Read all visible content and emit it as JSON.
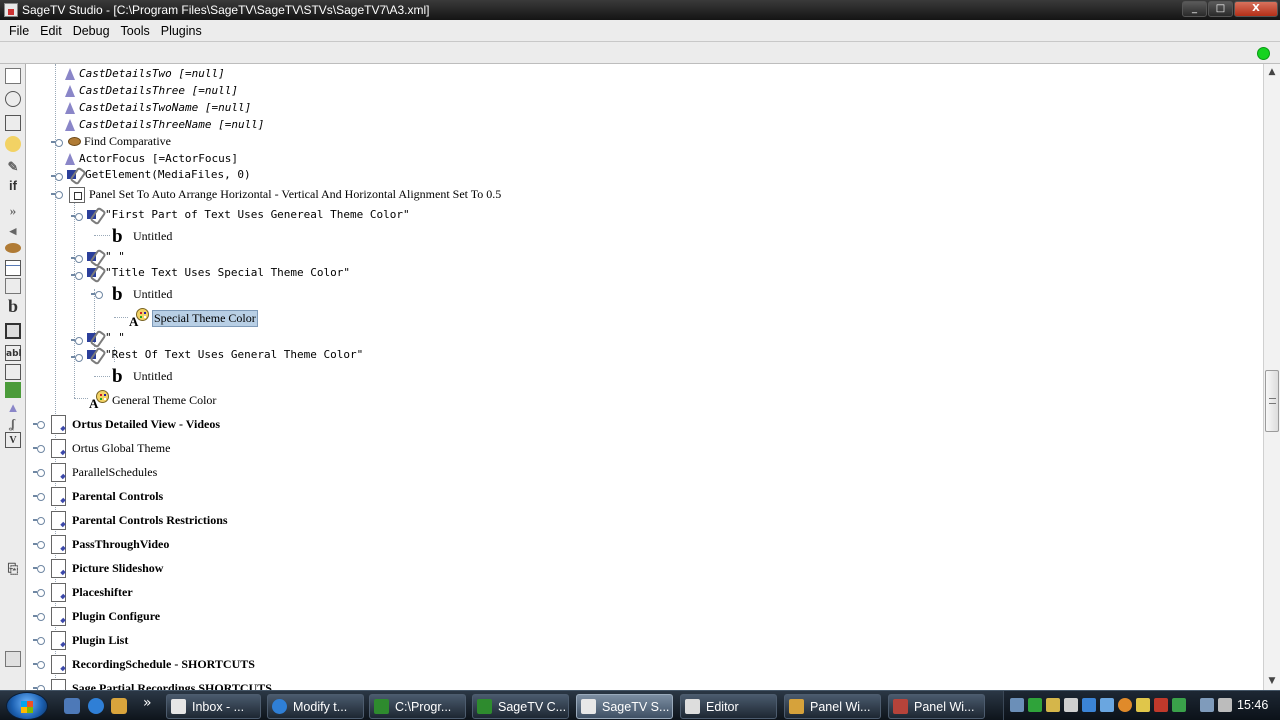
{
  "window": {
    "title": "SageTV Studio - [C:\\Program Files\\SageTV\\SageTV\\STVs\\SageTV7\\A3.xml]",
    "minimize": "_",
    "maximize": "□",
    "close": "X"
  },
  "menu": [
    "File",
    "Edit",
    "Debug",
    "Tools",
    "Plugins"
  ],
  "palette": [
    "menu-icon",
    "balloon-icon",
    "panel-icon",
    "theme-icon",
    "action-icon",
    "conditional-icon",
    "branch-icon",
    "sound-icon",
    "listener-icon",
    "table-icon",
    "table-component-icon",
    "text-icon",
    "image-icon",
    "textinput-icon",
    "video-icon",
    "effect-icon",
    "attribute-icon",
    "hook-icon",
    "shortcut-icon",
    "paste-icon",
    "trash-icon"
  ],
  "palette_glyphs": {
    "conditional": "if",
    "text": "b",
    "textinput": "abl"
  },
  "tree": {
    "r1": "CastDetailsTwo [=null]",
    "r2": "CastDetailsThree [=null]",
    "r3": "CastDetailsTwoName [=null]",
    "r4": "CastDetailsThreeName [=null]",
    "r5": "Find Comparative",
    "r6": "ActorFocus [=ActorFocus]",
    "r7": "GetElement(MediaFiles, 0)",
    "r8": "Panel Set To Auto Arrange Horizontal - Vertical And Horizontal Alignment Set To 0.5",
    "r9": "\"First Part of Text Uses Genereal Theme Color\"",
    "r10": "Untitled",
    "r11": "\" \"",
    "r12": "\"Title Text Uses Special Theme Color\"",
    "r13": "Untitled",
    "r14": "Special Theme Color",
    "r15": "\" \"",
    "r16": "\"Rest Of Text Uses General Theme Color\"",
    "r17": "Untitled",
    "r18": "General Theme Color",
    "menus": [
      "Ortus Detailed View - Videos",
      "Ortus Global Theme",
      "ParallelSchedules",
      "Parental Controls",
      "Parental Controls Restrictions",
      "PassThroughVideo",
      "Picture Slideshow",
      "Placeshifter",
      "Plugin Configure",
      "Plugin List",
      "RecordingSchedule - SHORTCUTS",
      "Sage Partial Recordings SHORTCUTS"
    ]
  },
  "taskbar": {
    "items": [
      "Inbox - ...",
      "Modify t...",
      "C:\\Progr...",
      "SageTV C...",
      "SageTV S...",
      "Editor",
      "Panel Wi...",
      "Panel Wi..."
    ],
    "clock": "15:46",
    "overflow": "»"
  },
  "colors": {
    "accent": "#15d320",
    "selection": "#b8cfe5",
    "titlebar": "#141414"
  }
}
